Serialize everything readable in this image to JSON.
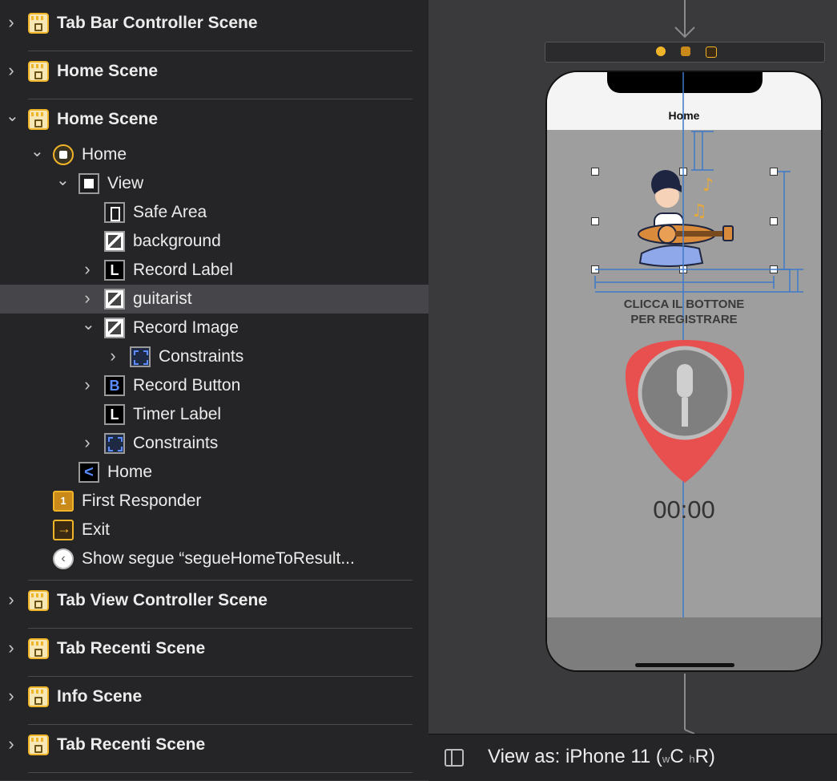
{
  "outline": {
    "items": [
      {
        "label": "Tab Bar Controller Scene",
        "icon": "scene-icon",
        "disclosure": "collapsed"
      },
      {
        "label": "Home Scene",
        "icon": "scene-icon",
        "disclosure": "collapsed"
      },
      {
        "label": "Home Scene",
        "icon": "scene-icon",
        "disclosure": "expanded"
      },
      {
        "label": "Home",
        "icon": "view-controller-icon",
        "disclosure": "expanded"
      },
      {
        "label": "View",
        "icon": "view-icon",
        "disclosure": "expanded"
      },
      {
        "label": "Safe Area",
        "icon": "safe-area-icon",
        "disclosure": "none"
      },
      {
        "label": "background",
        "icon": "image-view-icon",
        "disclosure": "none"
      },
      {
        "label": "Record Label",
        "icon": "label-icon",
        "disclosure": "collapsed"
      },
      {
        "label": "guitarist",
        "icon": "image-view-icon",
        "disclosure": "collapsed",
        "selected": true
      },
      {
        "label": "Record Image",
        "icon": "image-view-icon",
        "disclosure": "expanded"
      },
      {
        "label": "Constraints",
        "icon": "constraints-icon",
        "disclosure": "collapsed"
      },
      {
        "label": "Record Button",
        "icon": "button-icon",
        "disclosure": "collapsed"
      },
      {
        "label": "Timer Label",
        "icon": "label-icon",
        "disclosure": "none"
      },
      {
        "label": "Constraints",
        "icon": "constraints-icon",
        "disclosure": "collapsed"
      },
      {
        "label": "Home",
        "icon": "navigation-item-icon",
        "disclosure": "none"
      },
      {
        "label": "First Responder",
        "icon": "first-responder-icon",
        "disclosure": "none"
      },
      {
        "label": "Exit",
        "icon": "exit-icon",
        "disclosure": "none"
      },
      {
        "label": "Show segue “segueHomeToResult...",
        "icon": "segue-icon",
        "disclosure": "none"
      },
      {
        "label": "Tab View Controller Scene",
        "icon": "scene-icon",
        "disclosure": "collapsed"
      },
      {
        "label": "Tab Recenti Scene",
        "icon": "scene-icon",
        "disclosure": "collapsed"
      },
      {
        "label": "Info Scene",
        "icon": "scene-icon",
        "disclosure": "collapsed"
      },
      {
        "label": "Tab Recenti Scene",
        "icon": "scene-icon",
        "disclosure": "collapsed"
      }
    ]
  },
  "canvas": {
    "nav_title": "Home",
    "record_label": "CLICCA IL BOTTONE\nPER REGISTRARE",
    "timer": "00:00"
  },
  "bottom_bar": {
    "view_as_prefix": "View as: iPhone 11 (",
    "w_small": "w",
    "w_class": "C",
    "h_small": "h",
    "h_class": "R",
    "suffix": ")"
  },
  "colors": {
    "accent_blue": "#3f78c8",
    "pick_red": "#e84f4f",
    "scene_yellow": "#f0b429"
  }
}
